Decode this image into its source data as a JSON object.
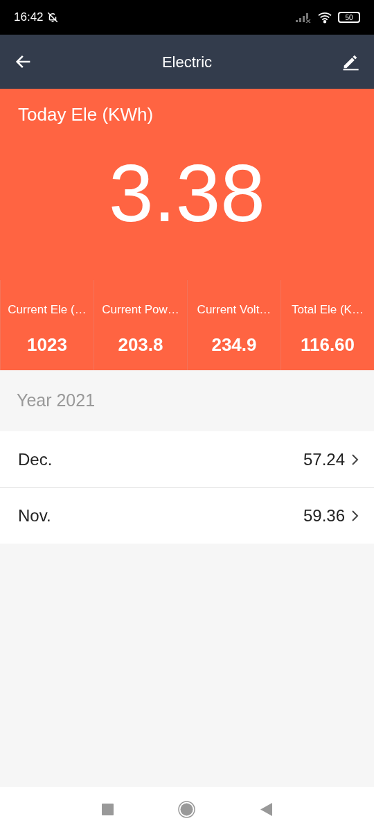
{
  "status_bar": {
    "time": "16:42",
    "battery": "50"
  },
  "header": {
    "title": "Electric"
  },
  "today": {
    "label": "Today Ele (KWh)",
    "value": "3.38"
  },
  "stats": [
    {
      "label": "Current Ele (…",
      "value": "1023"
    },
    {
      "label": "Current Pow…",
      "value": "203.8"
    },
    {
      "label": "Current Volt…",
      "value": "234.9"
    },
    {
      "label": "Total Ele (K…",
      "value": "116.60"
    }
  ],
  "year": {
    "title": "Year 2021"
  },
  "months": [
    {
      "name": "Dec.",
      "value": "57.24"
    },
    {
      "name": "Nov.",
      "value": "59.36"
    }
  ]
}
